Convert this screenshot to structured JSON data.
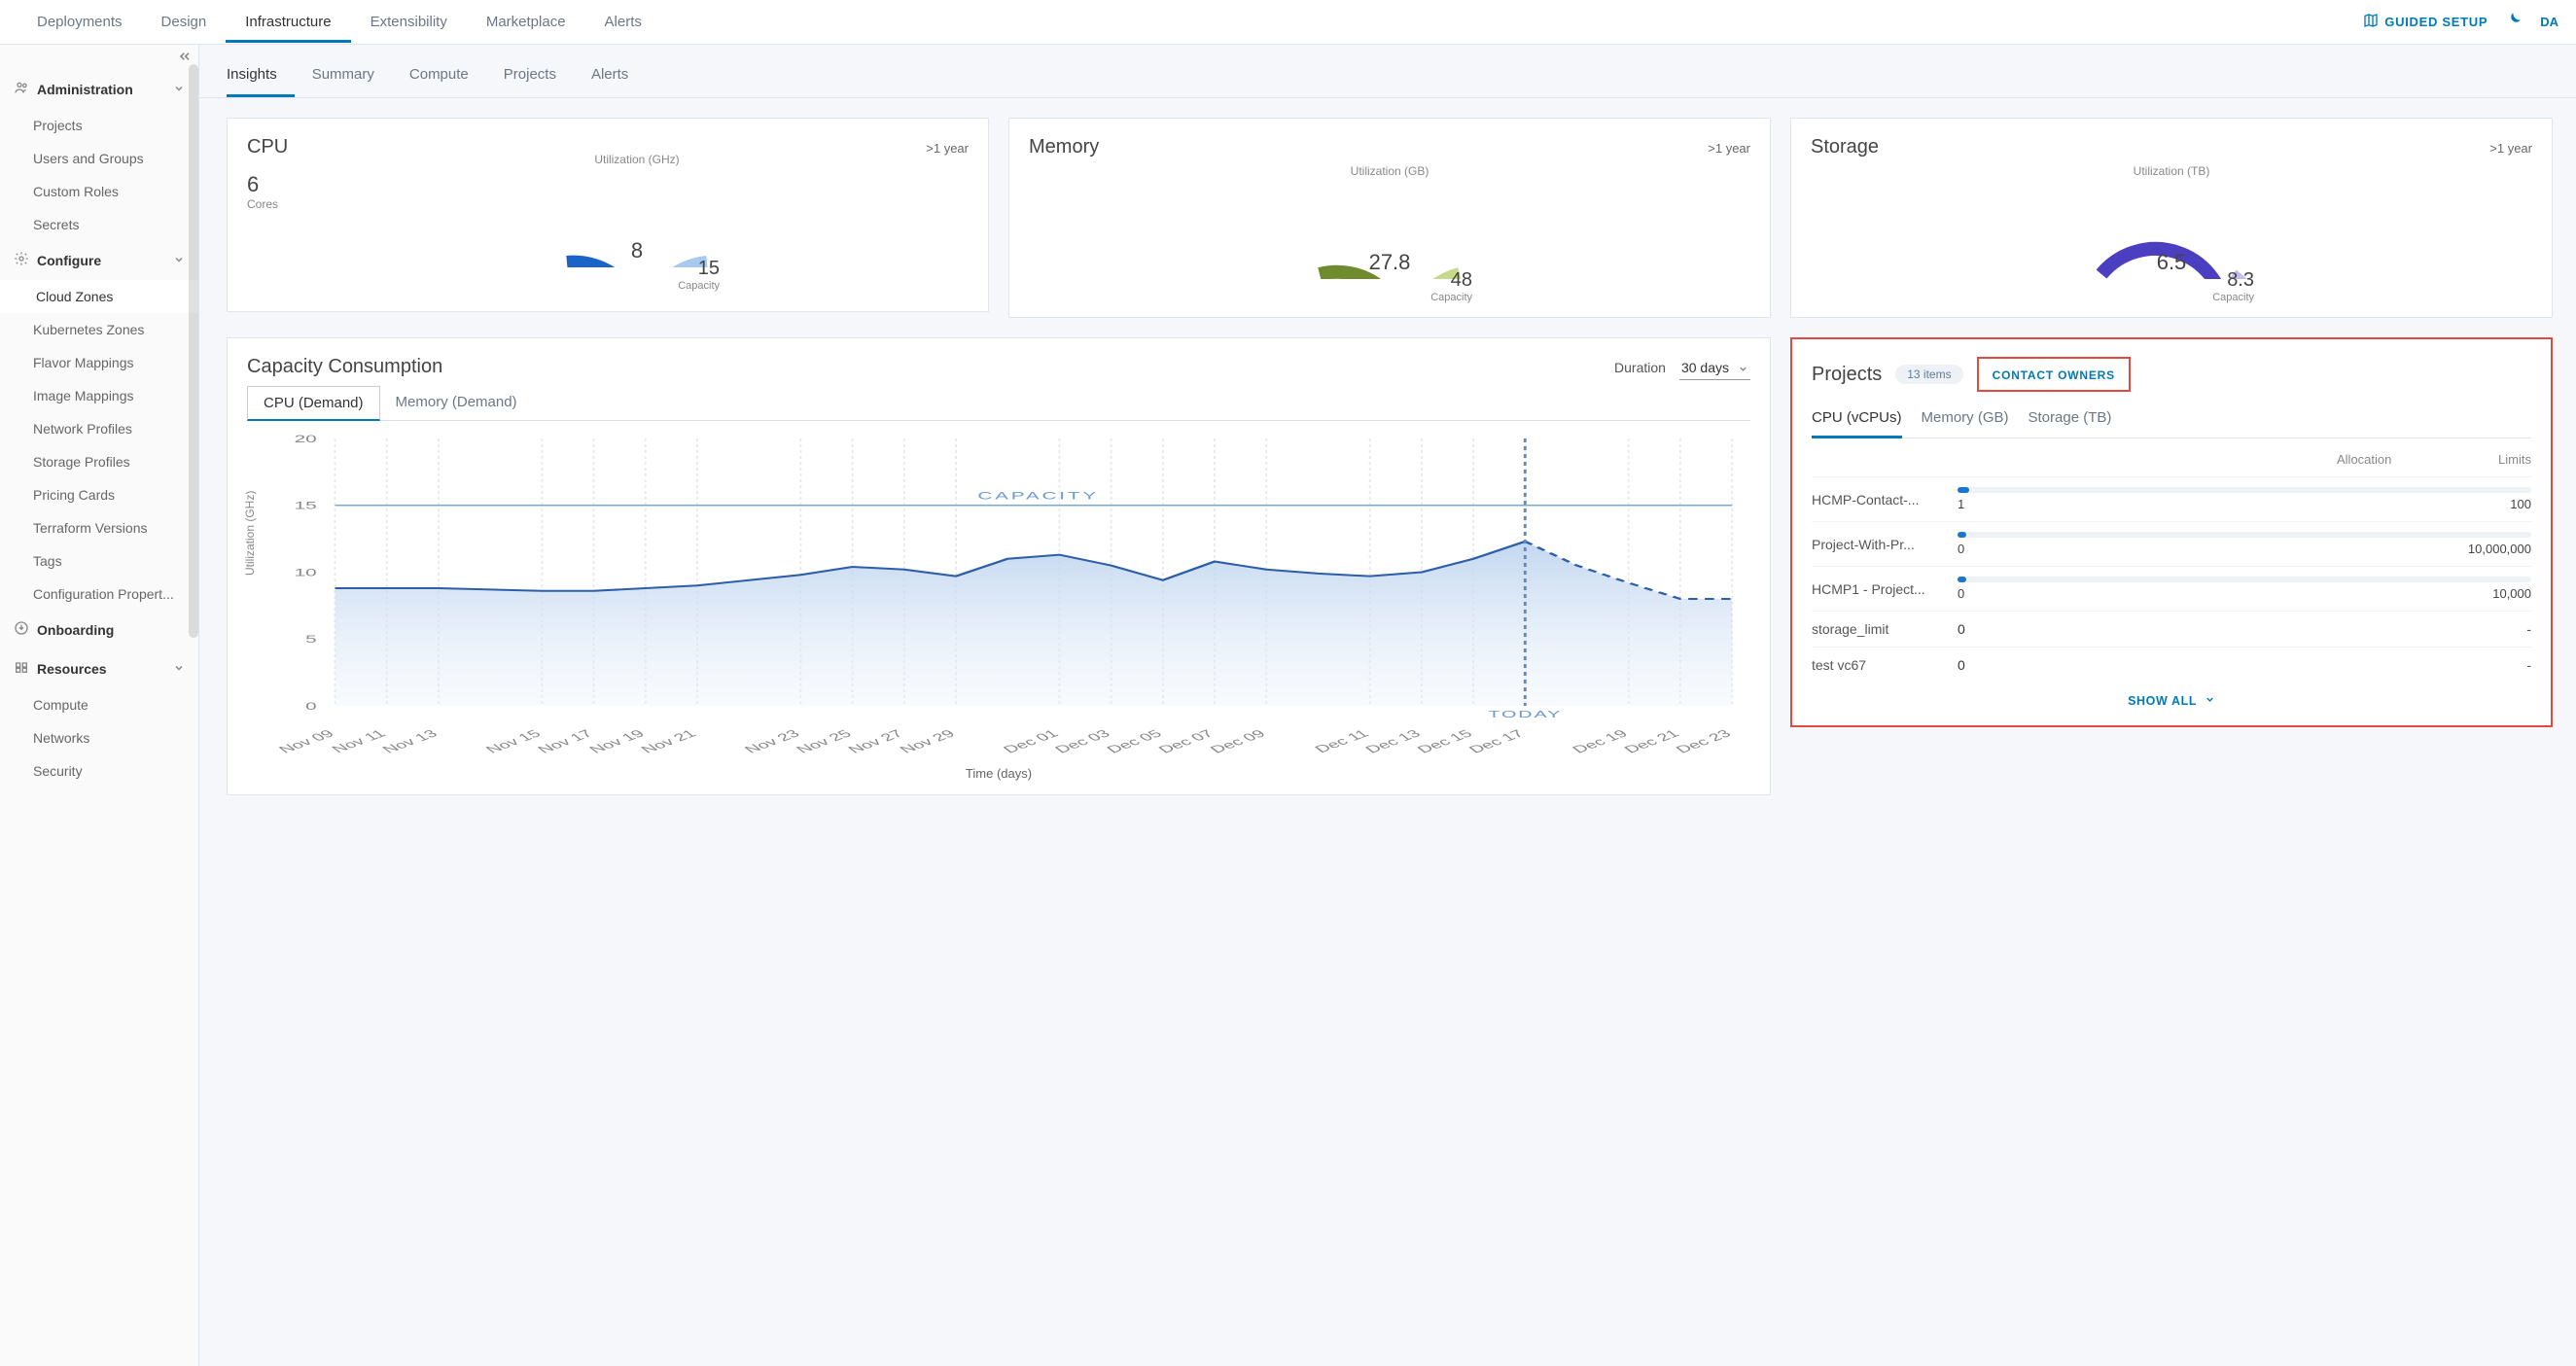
{
  "top_nav": {
    "items": [
      "Deployments",
      "Design",
      "Infrastructure",
      "Extensibility",
      "Marketplace",
      "Alerts"
    ],
    "guided_setup": "GUIDED SETUP",
    "dark_partial": "DA"
  },
  "sidebar": {
    "admin": {
      "title": "Administration",
      "items": [
        "Projects",
        "Users and Groups",
        "Custom Roles",
        "Secrets"
      ]
    },
    "configure": {
      "title": "Configure",
      "items": [
        "Cloud Zones",
        "Kubernetes Zones",
        "Flavor Mappings",
        "Image Mappings",
        "Network Profiles",
        "Storage Profiles",
        "Pricing Cards",
        "Terraform Versions",
        "Tags",
        "Configuration Propert..."
      ]
    },
    "onboarding": {
      "title": "Onboarding"
    },
    "resources": {
      "title": "Resources",
      "items": [
        "Compute",
        "Networks",
        "Security"
      ]
    }
  },
  "sub_tabs": [
    "Insights",
    "Summary",
    "Compute",
    "Projects",
    "Alerts"
  ],
  "gauges": {
    "cpu": {
      "title": "CPU",
      "time": ">1 year",
      "cores_value": "6",
      "cores_label": "Cores",
      "util_label": "Utilization (GHz)",
      "value": "8",
      "capacity": "15",
      "cap_label": "Capacity",
      "fraction": 0.53,
      "color_main": "#1c63c7",
      "color_rest": "#a7c8ef"
    },
    "memory": {
      "title": "Memory",
      "time": ">1 year",
      "util_label": "Utilization (GB)",
      "value": "27.8",
      "capacity": "48",
      "cap_label": "Capacity",
      "fraction": 0.58,
      "color_main": "#6f8b2e",
      "color_rest": "#c6d98a"
    },
    "storage": {
      "title": "Storage",
      "time": ">1 year",
      "util_label": "Utilization (TB)",
      "value": "6.5",
      "capacity": "8.3",
      "cap_label": "Capacity",
      "fraction": 0.78,
      "color_main": "#4b3ec1",
      "color_rest": "#c2bdee"
    }
  },
  "capacity": {
    "title": "Capacity Consumption",
    "duration_label": "Duration",
    "duration_value": "30 days",
    "tabs": [
      "CPU (Demand)",
      "Memory (Demand)"
    ],
    "ylabel": "Utilization (GHz)",
    "xlabel": "Time (days)",
    "capacity_label": "CAPACITY",
    "today_label": "TODAY"
  },
  "chart_data": {
    "type": "area",
    "title": "Capacity Consumption — CPU (Demand)",
    "xlabel": "Time (days)",
    "ylabel": "Utilization (GHz)",
    "ylim": [
      0,
      20
    ],
    "capacity_line": 15,
    "today_index": 23,
    "categories": [
      "Nov 09",
      "Nov 11",
      "Nov 13",
      "Nov 15",
      "Nov 17",
      "Nov 19",
      "Nov 21",
      "Nov 23",
      "Nov 25",
      "Nov 27",
      "Nov 29",
      "Dec 01",
      "Dec 03",
      "Dec 05",
      "Dec 07",
      "Dec 09",
      "Dec 11",
      "Dec 13",
      "Dec 15",
      "Dec 17",
      "Dec 19",
      "Dec 21",
      "Dec 23"
    ],
    "series": [
      {
        "name": "CPU Demand",
        "values": [
          8.8,
          8.8,
          8.8,
          8.7,
          8.6,
          8.6,
          8.8,
          9.0,
          9.4,
          9.8,
          10.4,
          10.2,
          9.7,
          11.0,
          11.3,
          10.5,
          9.4,
          10.8,
          10.2,
          9.9,
          9.7,
          10.0,
          11.0,
          12.3,
          10.5,
          9.2,
          8.0,
          8.0
        ],
        "style": "solid"
      },
      {
        "name": "CPU Demand (forecast)",
        "values_after_today": [
          8.0,
          8.05,
          8.1,
          8.15,
          8.2,
          8.25,
          8.3,
          8.3
        ],
        "style": "dashed"
      }
    ]
  },
  "projects": {
    "title": "Projects",
    "badge": "13 items",
    "contact": "CONTACT OWNERS",
    "tabs": [
      "CPU (vCPUs)",
      "Memory (GB)",
      "Storage (TB)"
    ],
    "head_alloc": "Allocation",
    "head_limits": "Limits",
    "rows": [
      {
        "name": "HCMP-Contact-...",
        "alloc": "1",
        "limit": "100",
        "bar_frac": 0.02
      },
      {
        "name": "Project-With-Pr...",
        "alloc": "0",
        "limit": "10,000,000",
        "bar_frac": 0
      },
      {
        "name": "HCMP1 - Project...",
        "alloc": "0",
        "limit": "10,000",
        "bar_frac": 0
      },
      {
        "name": "storage_limit",
        "alloc": "0",
        "limit": "-",
        "no_bar": true
      },
      {
        "name": "test vc67",
        "alloc": "0",
        "limit": "-",
        "no_bar": true
      }
    ],
    "show_all": "SHOW ALL"
  }
}
